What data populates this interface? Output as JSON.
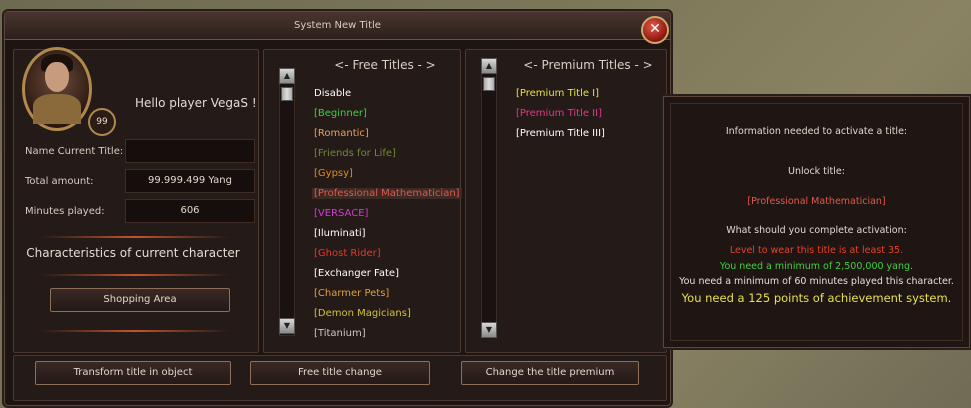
{
  "window": {
    "title": "System New Title",
    "close_glyph": "✕"
  },
  "player": {
    "greeting": "Hello player VegaS !",
    "level": "99"
  },
  "fields": {
    "name_label": "Name Current Title:",
    "name_value": "",
    "total_label": "Total amount:",
    "total_value": "99.999.499 Yang",
    "minutes_label": "Minutes played:",
    "minutes_value": "606"
  },
  "character": {
    "heading": "Characteristics of current character",
    "shopping_button": "Shopping Area"
  },
  "free_titles": {
    "heading": "<- Free Titles - >",
    "items": [
      {
        "label": "Disable",
        "color": "#ffffff"
      },
      {
        "label": "[Beginner]",
        "color": "#3fd13f"
      },
      {
        "label": "[Romantic]",
        "color": "#e6a15a"
      },
      {
        "label": "[Friends for Life]",
        "color": "#6f8a3a"
      },
      {
        "label": "[Gypsy]",
        "color": "#e08a2a"
      },
      {
        "label": "[Professional Mathematician]",
        "color": "#e05a4a",
        "selected": true
      },
      {
        "label": "[VERSACE]",
        "color": "#d63ad6"
      },
      {
        "label": "[Iluminati]",
        "color": "#ffffff"
      },
      {
        "label": "[Ghost Rider]",
        "color": "#e33a2a"
      },
      {
        "label": "[Exchanger Fate]",
        "color": "#ffffff"
      },
      {
        "label": "[Charmer Pets]",
        "color": "#e0a040"
      },
      {
        "label": "[Demon Magicians]",
        "color": "#d2c23a"
      },
      {
        "label": "[Titanium]",
        "color": "#d0c8c0"
      }
    ]
  },
  "premium_titles": {
    "heading": "<- Premium Titles - >",
    "items": [
      {
        "label": "[Premium Title I]",
        "color": "#e8e04a"
      },
      {
        "label": "[Premium Title II]",
        "color": "#e23a8a"
      },
      {
        "label": "[Premium Title III]",
        "color": "#ffffff"
      }
    ]
  },
  "info": {
    "line1": "Information needed to activate a title:",
    "unlock_label": "Unlock title:",
    "unlock_value": "[Professional Mathematician]",
    "question": "What should you complete activation:",
    "req_level": "Level to wear this title is at least 35.",
    "req_yang": "You need a minimum of 2,500,000 yang.",
    "req_minutes": "You need a minimum of 60 minutes played this character.",
    "req_achievement": "You need a 125 points of achievement system."
  },
  "buttons": {
    "transform": "Transform title in object",
    "free_change": "Free title change",
    "premium_change": "Change the title premium"
  },
  "scroll": {
    "up": "▲",
    "down": "▼"
  }
}
